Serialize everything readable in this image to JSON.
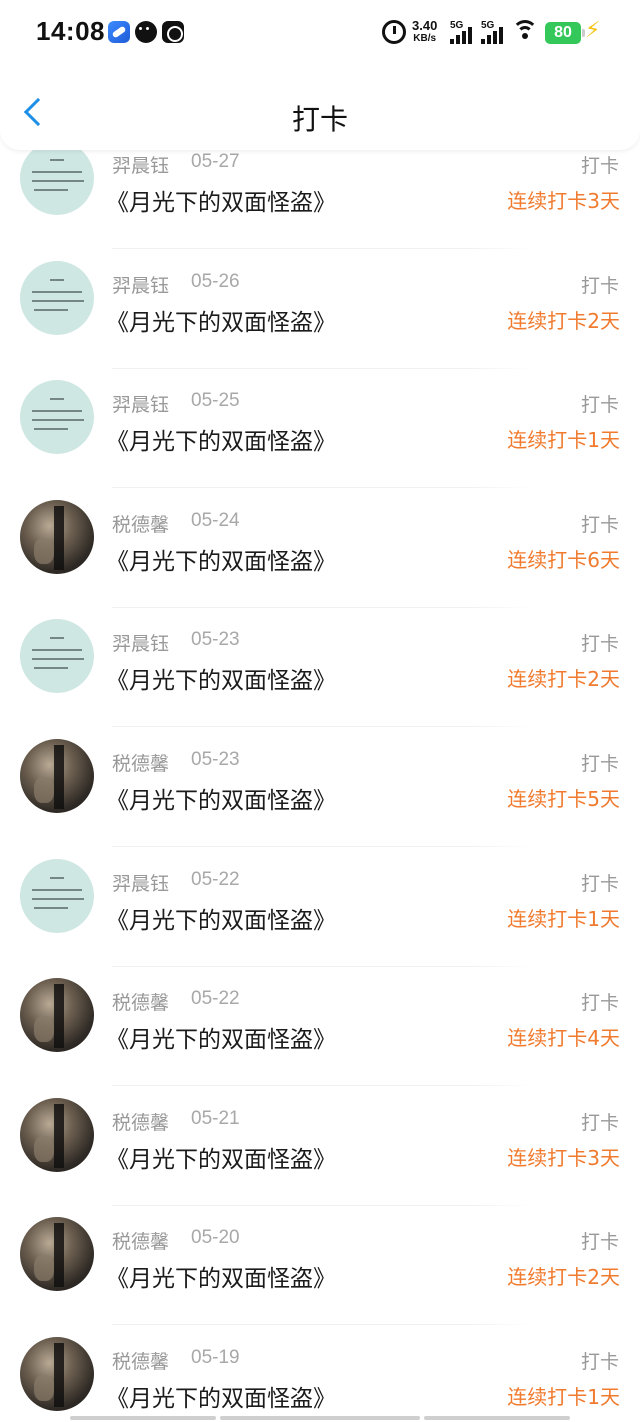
{
  "status_bar": {
    "time": "14:08",
    "net_speed_value": "3.40",
    "net_speed_unit": "KB/s",
    "signal_1": "5G",
    "signal_2": "5G",
    "battery": "80",
    "battery_color": "#34c759",
    "icons": [
      "browser-app-icon",
      "wechat-icon",
      "app-icon",
      "alarm-icon",
      "wifi-icon",
      "battery-icon",
      "charging-bolt-icon"
    ]
  },
  "nav": {
    "title": "打卡",
    "back_icon": "chevron-left-icon",
    "accent_color": "#1e90e8"
  },
  "entries": [
    {
      "name": "羿晨钰",
      "date": "05-27",
      "type": "打卡",
      "book": "《月光下的双面怪盗》",
      "streak": "连续打卡3天",
      "avatar": "teal"
    },
    {
      "name": "羿晨钰",
      "date": "05-26",
      "type": "打卡",
      "book": "《月光下的双面怪盗》",
      "streak": "连续打卡2天",
      "avatar": "teal"
    },
    {
      "name": "羿晨钰",
      "date": "05-25",
      "type": "打卡",
      "book": "《月光下的双面怪盗》",
      "streak": "连续打卡1天",
      "avatar": "teal"
    },
    {
      "name": "税德馨",
      "date": "05-24",
      "type": "打卡",
      "book": "《月光下的双面怪盗》",
      "streak": "连续打卡6天",
      "avatar": "dark"
    },
    {
      "name": "羿晨钰",
      "date": "05-23",
      "type": "打卡",
      "book": "《月光下的双面怪盗》",
      "streak": "连续打卡2天",
      "avatar": "teal"
    },
    {
      "name": "税德馨",
      "date": "05-23",
      "type": "打卡",
      "book": "《月光下的双面怪盗》",
      "streak": "连续打卡5天",
      "avatar": "dark"
    },
    {
      "name": "羿晨钰",
      "date": "05-22",
      "type": "打卡",
      "book": "《月光下的双面怪盗》",
      "streak": "连续打卡1天",
      "avatar": "teal"
    },
    {
      "name": "税德馨",
      "date": "05-22",
      "type": "打卡",
      "book": "《月光下的双面怪盗》",
      "streak": "连续打卡4天",
      "avatar": "dark"
    },
    {
      "name": "税德馨",
      "date": "05-21",
      "type": "打卡",
      "book": "《月光下的双面怪盗》",
      "streak": "连续打卡3天",
      "avatar": "dark"
    },
    {
      "name": "税德馨",
      "date": "05-20",
      "type": "打卡",
      "book": "《月光下的双面怪盗》",
      "streak": "连续打卡2天",
      "avatar": "dark"
    },
    {
      "name": "税德馨",
      "date": "05-19",
      "type": "打卡",
      "book": "《月光下的双面怪盗》",
      "streak": "连续打卡1天",
      "avatar": "dark"
    }
  ],
  "colors": {
    "streak": "#f07a2d",
    "meta_text": "#999999"
  }
}
